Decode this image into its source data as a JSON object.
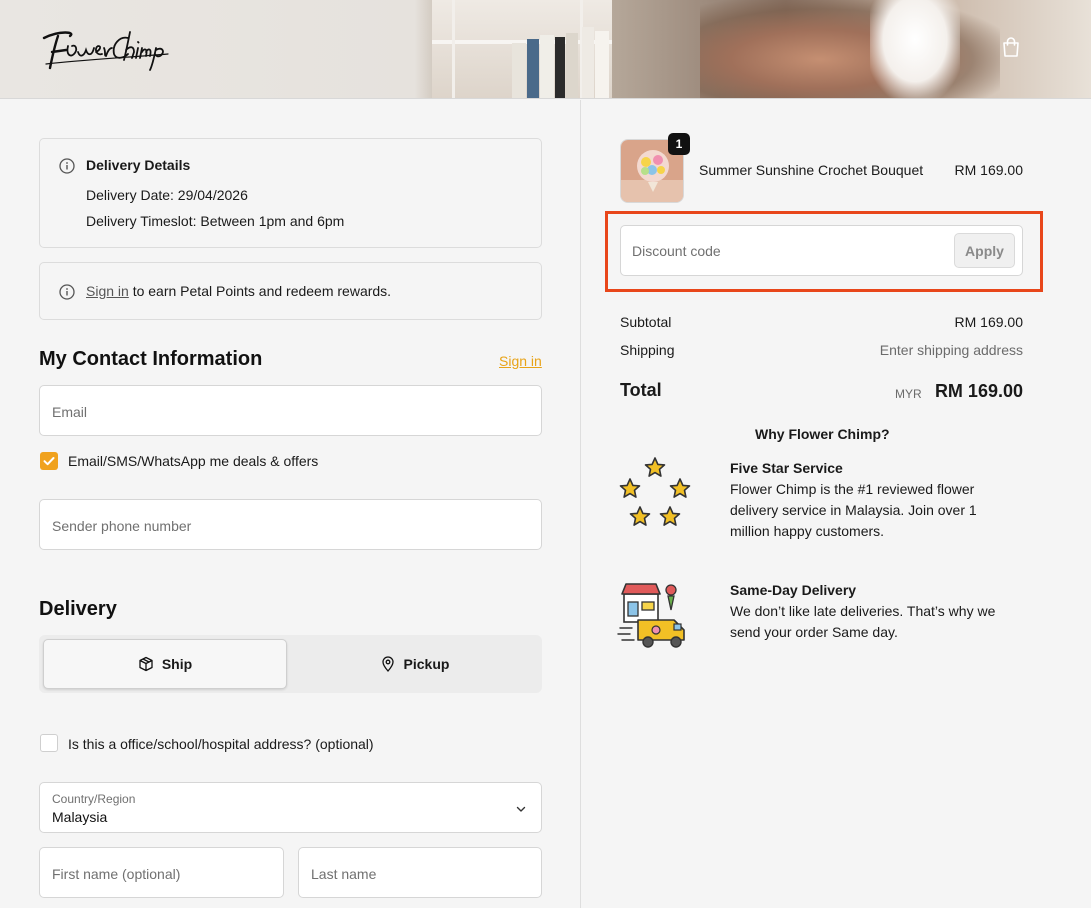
{
  "header": {
    "brand": "FlowerChimp",
    "cart_icon": "shopping-bag-icon"
  },
  "delivery_details": {
    "title": "Delivery Details",
    "date": "Delivery Date: 29/04/2026",
    "timeslot": "Delivery Timeslot: Between 1pm and 6pm"
  },
  "signin_banner": {
    "link": "Sign in",
    "text": " to earn Petal Points and redeem rewards."
  },
  "contact": {
    "heading": "My Contact Information",
    "signin_link": "Sign in",
    "email_placeholder": "Email",
    "marketing_label": "Email/SMS/WhatsApp me deals & offers",
    "marketing_checked": true,
    "phone_placeholder": "Sender phone number"
  },
  "delivery": {
    "heading": "Delivery",
    "ship_label": "Ship",
    "pickup_label": "Pickup",
    "office_label": "Is this a office/school/hospital address? (optional)",
    "country_label": "Country/Region",
    "country_value": "Malaysia",
    "first_name_placeholder": "First name (optional)",
    "last_name_placeholder": "Last name"
  },
  "order": {
    "item_name": "Summer Sunshine Crochet Bouquet",
    "item_price": "RM 169.00",
    "quantity": "1",
    "discount_placeholder": "Discount code",
    "apply_label": "Apply",
    "subtotal_label": "Subtotal",
    "subtotal_value": "RM 169.00",
    "shipping_label": "Shipping",
    "shipping_value": "Enter shipping address",
    "total_label": "Total",
    "currency": "MYR",
    "total_value": "RM 169.00"
  },
  "why": {
    "heading": "Why Flower Chimp?",
    "features": [
      {
        "title": "Five Star Service",
        "desc": "Flower Chimp is the #1 reviewed flower delivery service in Malaysia. Join over 1 million happy customers."
      },
      {
        "title": "Same-Day Delivery",
        "desc": "We don’t like late deliveries. That’s why we send your order Same day."
      }
    ]
  },
  "colors": {
    "accent": "#f0a21e",
    "link": "#e8a317",
    "highlight": "#e8461a"
  }
}
